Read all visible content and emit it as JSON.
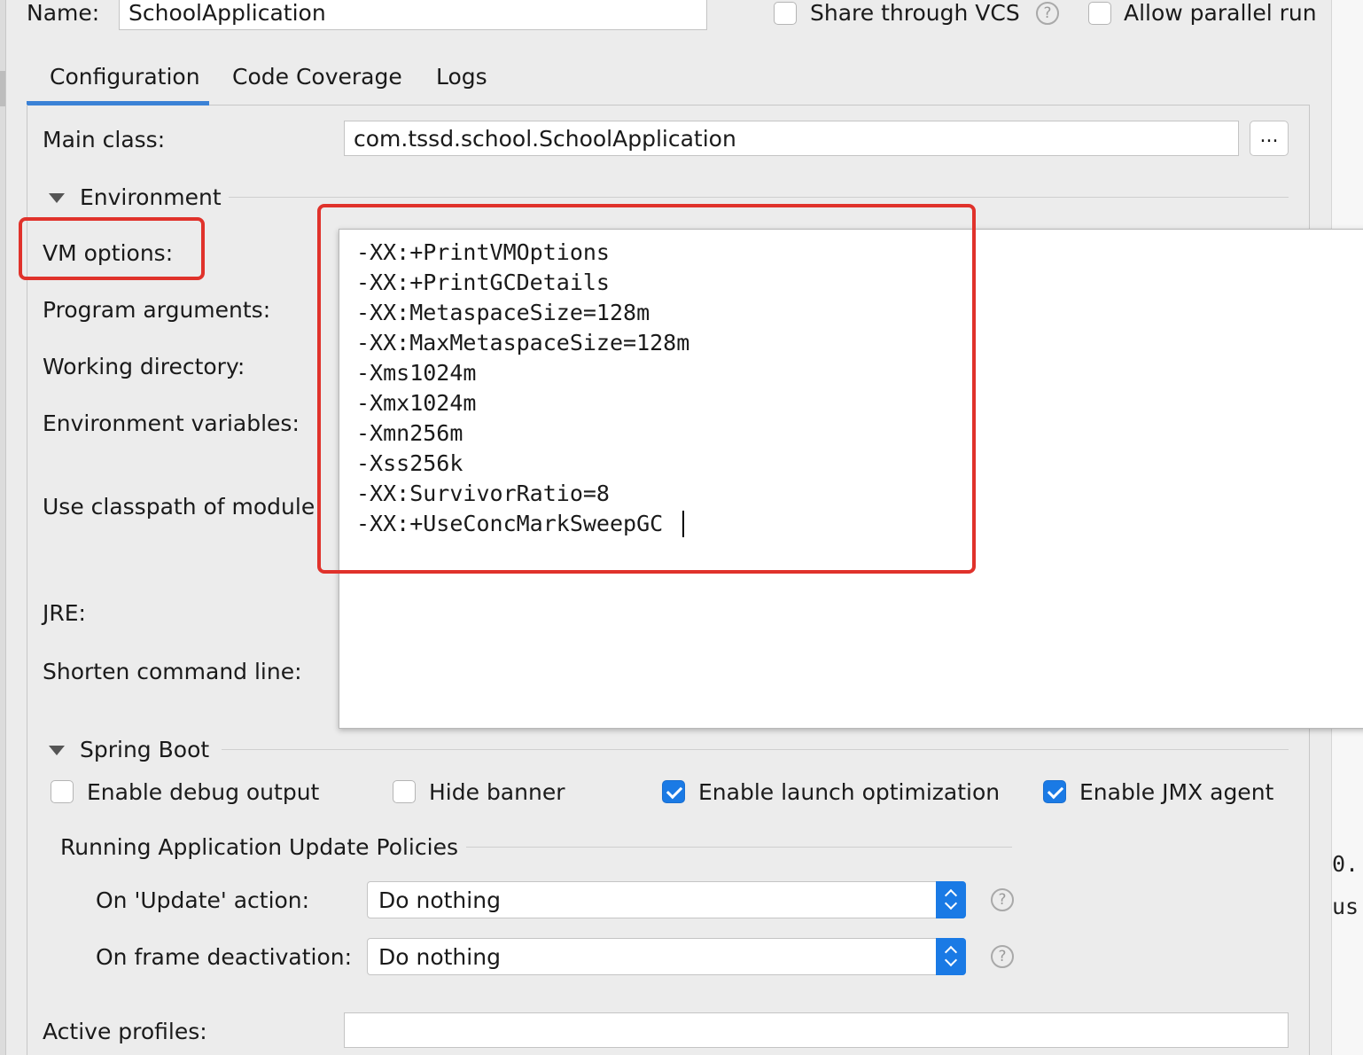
{
  "header": {
    "name_label": "Name:",
    "name_value": "SchoolApplication",
    "share_vcs_label": "Share through VCS",
    "share_vcs_checked": false,
    "allow_parallel_label": "Allow parallel run",
    "allow_parallel_checked": false,
    "help_glyph": "?"
  },
  "tabs": [
    {
      "label": "Configuration",
      "active": true
    },
    {
      "label": "Code Coverage",
      "active": false
    },
    {
      "label": "Logs",
      "active": false
    }
  ],
  "config": {
    "main_class_label": "Main class:",
    "main_class_value": "com.tssd.school.SchoolApplication",
    "browse_label": "...",
    "environment_section": "Environment",
    "vm_options_label": "VM options:",
    "program_arguments_label": "Program arguments:",
    "working_directory_label": "Working directory:",
    "environment_variables_label": "Environment variables:",
    "use_classpath_label": "Use classpath of module:",
    "jre_label": "JRE:",
    "shorten_command_label": "Shorten command line:",
    "active_profiles_label": "Active profiles:",
    "active_profiles_value": ""
  },
  "vm_options_editor": {
    "lines": [
      "-XX:+PrintVMOptions",
      "-XX:+PrintGCDetails",
      "-XX:MetaspaceSize=128m",
      "-XX:MaxMetaspaceSize=128m",
      "-Xms1024m",
      "-Xmx1024m",
      "-Xmn256m",
      "-Xss256k",
      "-XX:SurvivorRatio=8",
      "-XX:+UseConcMarkSweepGC"
    ]
  },
  "spring_boot": {
    "section_title": "Spring Boot",
    "checkboxes": [
      {
        "label": "Enable debug output",
        "checked": false
      },
      {
        "label": "Hide banner",
        "checked": false
      },
      {
        "label": "Enable launch optimization",
        "checked": true
      },
      {
        "label": "Enable JMX agent",
        "checked": true
      }
    ],
    "policies_title": "Running Application Update Policies",
    "on_update_label": "On 'Update' action:",
    "on_update_value": "Do nothing",
    "on_frame_label": "On frame deactivation:",
    "on_frame_value": "Do nothing"
  },
  "background_editor": {
    "line1": "0.",
    "line2": "us"
  },
  "colors": {
    "highlight_red": "#e0322b",
    "accent_blue": "#1a7ae5",
    "tab_underline": "#3b82d6"
  }
}
